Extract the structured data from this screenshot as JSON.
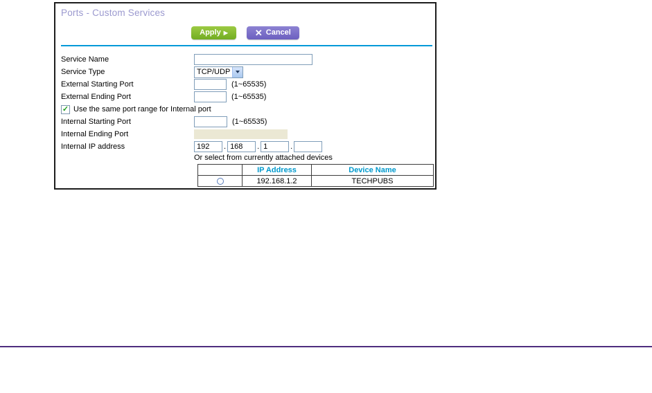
{
  "panel": {
    "title": "Ports - Custom Services",
    "apply_label": "Apply",
    "apply_arrow": "▶",
    "cancel_x": "✕",
    "cancel_label": "Cancel"
  },
  "form": {
    "service_name": {
      "label": "Service Name",
      "value": ""
    },
    "service_type": {
      "label": "Service Type",
      "value": "TCP/UDP"
    },
    "external_starting_port": {
      "label": "External Starting Port",
      "value": "",
      "hint": "(1~65535)"
    },
    "external_ending_port": {
      "label": "External Ending Port",
      "value": "",
      "hint": "(1~65535)"
    },
    "same_port_checkbox": {
      "label": "Use the same port range for Internal port",
      "checked": true,
      "mark": "✓"
    },
    "internal_starting_port": {
      "label": "Internal Starting Port",
      "value": "",
      "hint": "(1~65535)"
    },
    "internal_ending_port": {
      "label": "Internal Ending Port",
      "value": ""
    },
    "internal_ip": {
      "label": "Internal IP address",
      "octets": [
        "192",
        "168",
        "1",
        ""
      ],
      "separator": "."
    },
    "attached_devices_note": "Or select from currently attached devices"
  },
  "devices_table": {
    "headers": {
      "ip": "IP Address",
      "device": "Device Name"
    },
    "rows": [
      {
        "ip": "192.168.1.2",
        "device_name": "TECHPUBS",
        "selected": false
      }
    ]
  },
  "colors": {
    "title": "#9b99cf",
    "divider_blue": "#0099d8",
    "apply_green": "#72ad22",
    "cancel_purple": "#6c5fc0",
    "table_header_blue": "#0099cc",
    "bottom_line_purple": "#4e2d7e",
    "disabled_field_beige": "#ebe8d4"
  }
}
